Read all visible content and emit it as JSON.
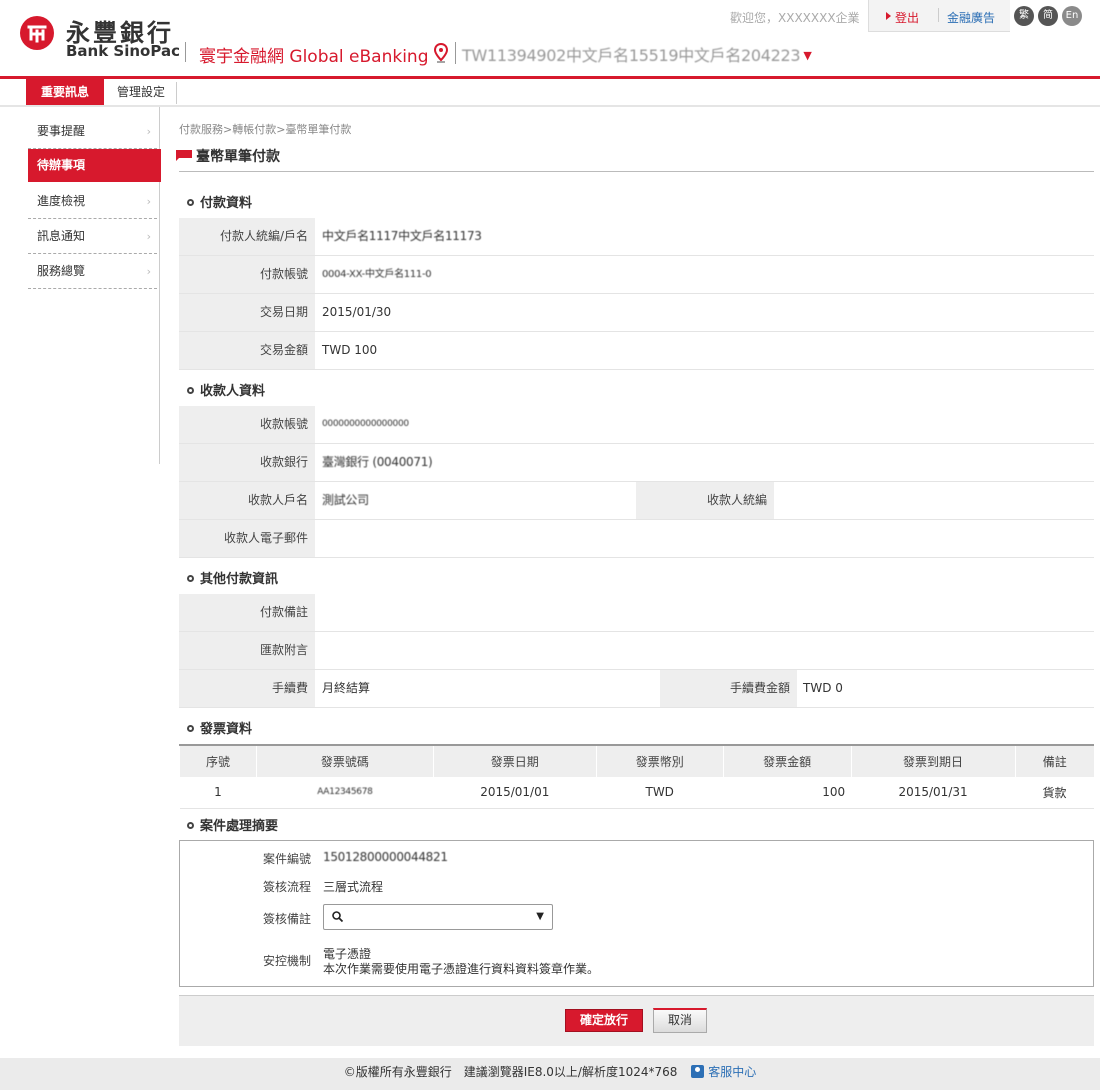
{
  "header": {
    "bank_name_zh": "永豐銀行",
    "bank_name_en": "Bank SinoPac",
    "product": "寰宇金融網 Global eBanking",
    "account_selector": "TW11394902中文戶名15519中文戶名204223",
    "welcome": "歡迎您，XXXXXXX企業",
    "logout": "登出",
    "fin_ad": "金融廣告",
    "lang": [
      "繁",
      "简",
      "En"
    ]
  },
  "nav": {
    "tabs": [
      {
        "label": "重要訊息"
      },
      {
        "label": "管理設定"
      }
    ]
  },
  "sidebar": {
    "items": [
      {
        "label": "要事提醒"
      },
      {
        "label": "待辦事項"
      },
      {
        "label": "進度檢視"
      },
      {
        "label": "訊息通知"
      },
      {
        "label": "服務總覽"
      }
    ]
  },
  "breadcrumb": [
    "付款服務",
    "轉帳付款",
    "臺幣單筆付款"
  ],
  "page_title": "臺幣單筆付款",
  "payment_info": {
    "heading": "付款資料",
    "payer_id_label": "付款人統編/戶名",
    "payer_id_value": "中文戶名1117中文戶名11173",
    "account_label": "付款帳號",
    "account_value": "0004-XX-中文戶名111-0",
    "date_label": "交易日期",
    "date_value": "2015/01/30",
    "amount_label": "交易金額",
    "amount_value": "TWD 100"
  },
  "payee_info": {
    "heading": "收款人資料",
    "account_label": "收款帳號",
    "account_value": "0000000000000000",
    "bank_label": "收款銀行",
    "bank_value": "臺灣銀行 (0040071)",
    "name_label": "收款人戶名",
    "name_value": "測試公司",
    "tax_id_label": "收款人統編",
    "tax_id_value": "",
    "email_label": "收款人電子郵件",
    "email_value": ""
  },
  "other_info": {
    "heading": "其他付款資訊",
    "note_label": "付款備註",
    "note_value": "",
    "remit_label": "匯款附言",
    "remit_value": "",
    "fee_label": "手續費",
    "fee_value": "月終結算",
    "fee_amount_label": "手續費金額",
    "fee_amount_value": "TWD 0"
  },
  "invoice": {
    "heading": "發票資料",
    "columns": [
      "序號",
      "發票號碼",
      "發票日期",
      "發票幣別",
      "發票金額",
      "發票到期日",
      "備註"
    ],
    "rows": [
      [
        "1",
        "AA12345678",
        "2015/01/01",
        "TWD",
        "100",
        "2015/01/31",
        "貨款"
      ]
    ]
  },
  "case_summary": {
    "heading": "案件處理摘要",
    "case_no_label": "案件編號",
    "case_no_value": "15012800000044821",
    "flow_label": "簽核流程",
    "flow_value": "三層式流程",
    "remark_label": "簽核備註",
    "remark_value": "",
    "security_label": "安控機制",
    "security_value": "電子憑證",
    "security_note": "本次作業需要使用電子憑證進行資料資料簽章作業。"
  },
  "actions": {
    "confirm": "確定放行",
    "cancel": "取消"
  },
  "footer": {
    "text": "©版權所有永豐銀行　建議瀏覽器IE8.0以上/解析度1024*768",
    "customer_service": "客服中心"
  },
  "colors": {
    "brand": "#d7192d",
    "link": "#2c6fb5"
  }
}
